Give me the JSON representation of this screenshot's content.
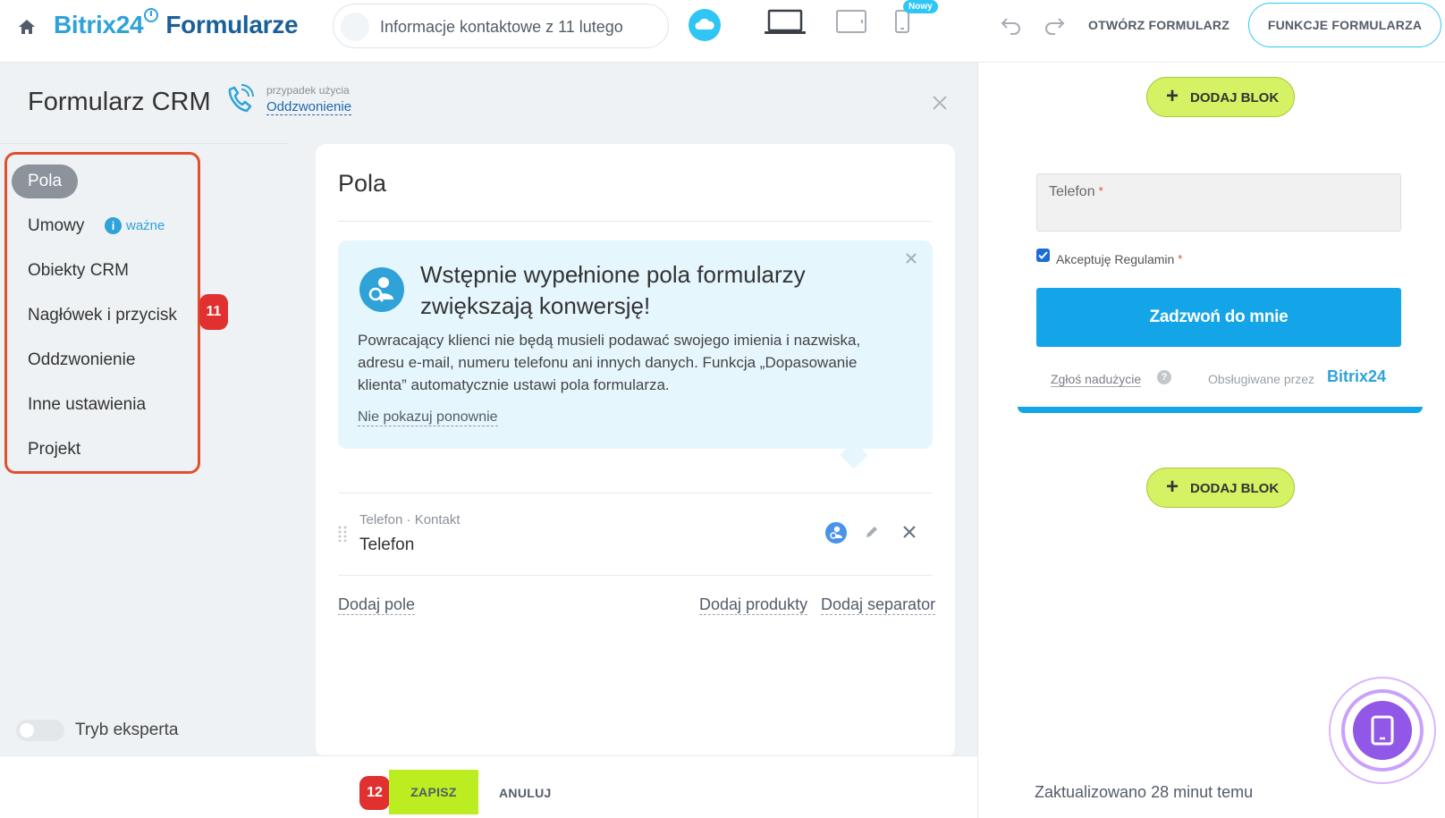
{
  "topbar": {
    "brand_b24": "Bitrix24",
    "brand_forms": "Formularze",
    "form_title": "Informacje kontaktowe z 11 lutego",
    "badge_new": "Nowy",
    "open_form_label": "OTWÓRZ FORMULARZ",
    "features_label": "FUNKCJE FORMULARZA"
  },
  "panel": {
    "title": "Formularz CRM",
    "usecase_label": "przypadek użycia",
    "usecase_value": "Oddzwonienie",
    "nav": [
      {
        "label": "Pola"
      },
      {
        "label": "Umowy"
      },
      {
        "label": "Obiekty CRM"
      },
      {
        "label": "Nagłówek i przycisk"
      },
      {
        "label": "Oddzwonienie"
      },
      {
        "label": "Inne ustawienia"
      },
      {
        "label": "Projekt"
      }
    ],
    "important_label": "ważne",
    "info_glyph": "i",
    "step_badge_nav": "11",
    "expert_mode_label": "Tryb eksperta"
  },
  "card": {
    "title": "Pola",
    "hint": {
      "title": "Wstępnie wypełnione pola formularzy zwiększają konwersję!",
      "body": "Powracający klienci nie będą musieli podawać swojego imienia i nazwiska, adresu e-mail, numeru telefonu ani innych danych. Funkcja „Dopasowanie klienta” automatycznie ustawi pola formularza.",
      "dismiss": "Nie pokazuj ponownie"
    },
    "field": {
      "meta": "Telefon · Kontakt",
      "name": "Telefon"
    },
    "add_field": "Dodaj pole",
    "add_products": "Dodaj produkty",
    "add_separator": "Dodaj separator"
  },
  "footer": {
    "step_badge_save": "12",
    "save_label": "ZAPISZ",
    "cancel_label": "ANULUJ"
  },
  "preview": {
    "add_block_label": "DODAJ BLOK",
    "phone_label": "Telefon",
    "required_mark": "*",
    "terms_label": "Akceptuję Regulamin",
    "call_button": "Zadzwoń do mnie",
    "abuse_link": "Zgłoś nadużycie",
    "help_glyph": "?",
    "powered_by": "Obsługiwane przez",
    "powered_brand": "Bitrix24",
    "updated_text": "Zaktualizowano 28 minut temu"
  },
  "colors": {
    "accent": "#2fc6f6",
    "brand_blue": "#2fa2d8",
    "save_green": "#bbed21",
    "add_block_green": "#d4f263",
    "highlight_red": "#e0502f",
    "call_button_blue": "#13a5e7",
    "fab_purple": "#9157e6"
  },
  "icons": {
    "home": "home-icon",
    "cloud": "cloud-icon",
    "laptop": "laptop-icon",
    "tablet": "tablet-icon",
    "phone_device": "smartphone-icon",
    "undo": "undo-icon",
    "redo": "redo-icon",
    "phone_call": "phone-call-icon",
    "close": "close-icon",
    "customer_match": "user-search-icon",
    "edit": "pencil-icon",
    "drag": "drag-handle-icon",
    "mobile_preview": "mobile-preview-icon"
  }
}
